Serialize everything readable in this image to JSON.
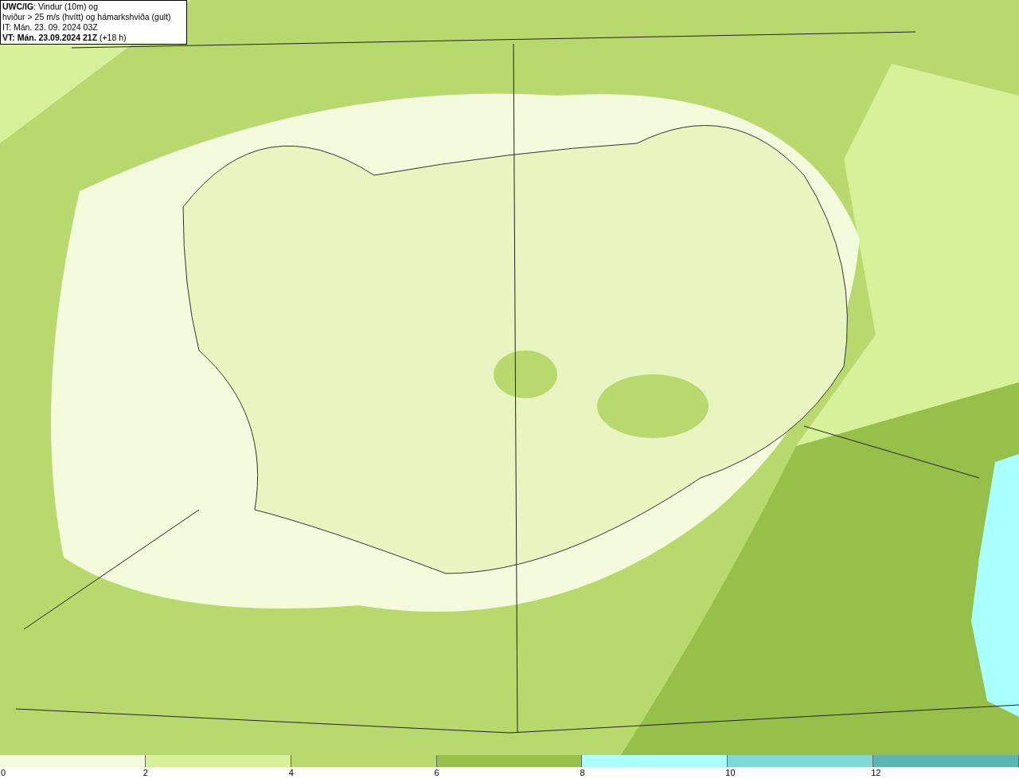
{
  "title_box": {
    "lines": [
      "**UWC/IG**: Vindur (10m) og",
      "hviður > 25 m/s (hvítt) og hámarkshviða (gult)",
      "IT: Mán. 23. 09. 2024 03Z",
      "**VT: Mán. 23.09.2024 21Z** (+18 h)"
    ]
  },
  "legend": {
    "bins": [
      {
        "color": "#f4fadc"
      },
      {
        "color": "#d7f09a"
      },
      {
        "color": "#b8d96e"
      },
      {
        "color": "#97c04a"
      },
      {
        "color": "#aaffff"
      },
      {
        "color": "#80d8d8"
      },
      {
        "color": "#5bb5b5"
      }
    ],
    "ticks": [
      "0",
      "2",
      "4",
      "6",
      "8",
      "10",
      "12"
    ]
  }
}
